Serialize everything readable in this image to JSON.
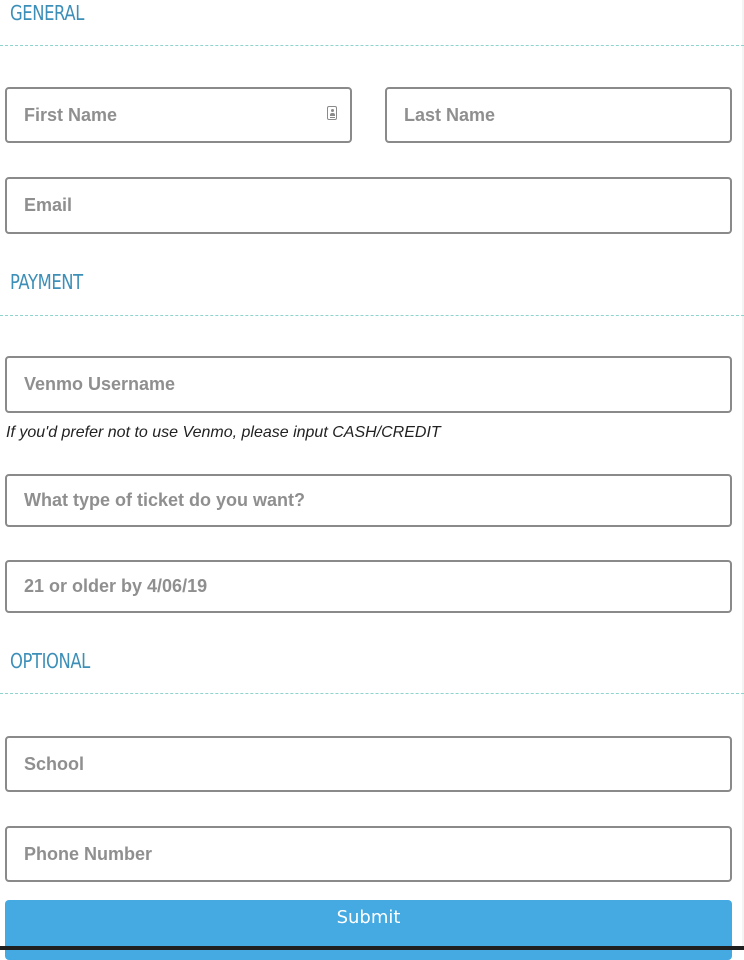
{
  "colors": {
    "section_heading": "#3d8fb8",
    "divider": "#8fd3cf",
    "submit_background": "#45a9e2",
    "input_border": "#8a8a8a"
  },
  "sections": {
    "general": {
      "title": "GENERAL"
    },
    "payment": {
      "title": "PAYMENT"
    },
    "optional": {
      "title": "OPTIONAL"
    }
  },
  "fields": {
    "first_name": {
      "placeholder": "First Name",
      "icon": "contact-card-icon"
    },
    "last_name": {
      "placeholder": "Last Name"
    },
    "email": {
      "placeholder": "Email"
    },
    "venmo": {
      "placeholder": "Venmo Username",
      "help": "If you'd prefer not to use Venmo, please input CASH/CREDIT"
    },
    "ticket_type": {
      "placeholder": "What type of ticket do you want?"
    },
    "age": {
      "placeholder": "21 or older by 4/06/19"
    },
    "school": {
      "placeholder": "School"
    },
    "phone": {
      "placeholder": "Phone Number"
    }
  },
  "submit": {
    "label": "Submit"
  }
}
